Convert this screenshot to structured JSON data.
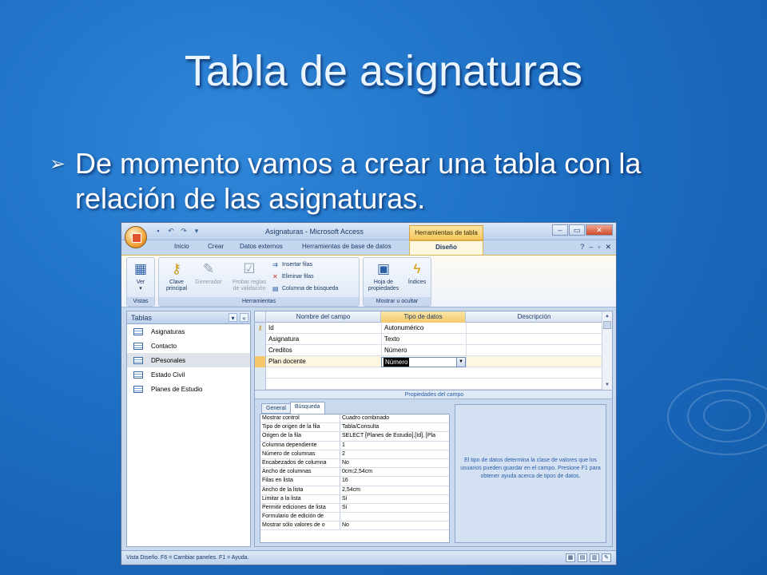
{
  "slide": {
    "title": "Tabla de asignaturas",
    "bullet_text": "De momento vamos a crear una tabla con la relación de las asignaturas."
  },
  "window": {
    "title": "Asignaturas - Microsoft Access",
    "context_tab": "Herramientas de tabla"
  },
  "ribbon_tabs": [
    "Inicio",
    "Crear",
    "Datos externos",
    "Herramientas de base de datos",
    "Diseño"
  ],
  "ribbon": {
    "vistas": {
      "label": "Vistas",
      "ver": "Ver"
    },
    "herramientas": {
      "label": "Herramientas",
      "clave_line1": "Clave",
      "clave_line2": "principal",
      "generador": "Generador",
      "probar_line1": "Probar reglas",
      "probar_line2": "de validación",
      "insertar": "Insertar filas",
      "eliminar": "Eliminar filas",
      "columna": "Columna de búsqueda"
    },
    "mostrar": {
      "label": "Mostrar u ocultar",
      "hoja_line1": "Hoja de",
      "hoja_line2": "propiedades",
      "indices": "Índices"
    }
  },
  "nav": {
    "header": "Tablas",
    "items": [
      "Asignaturas",
      "Contacto",
      "DPesonales",
      "Estado Civil",
      "Planes de Estudio"
    ],
    "selected_index": 2
  },
  "design_grid": {
    "headers": [
      "Nombre del campo",
      "Tipo de datos",
      "Descripción"
    ],
    "rows": [
      {
        "name": "Id",
        "type": "Autonumérico"
      },
      {
        "name": "Asignatura",
        "type": "Texto"
      },
      {
        "name": "Creditos",
        "type": "Número"
      },
      {
        "name": "Plan docente",
        "type": "Número"
      }
    ]
  },
  "properties": {
    "title": "Propiedades del campo",
    "tabs": [
      "General",
      "Búsqueda"
    ],
    "active_tab": "Búsqueda",
    "rows": [
      {
        "name": "Mostrar control",
        "value": "Cuadro combinado"
      },
      {
        "name": "Tipo de origen de la fila",
        "value": "Tabla/Consulta"
      },
      {
        "name": "Origen de la fila",
        "value": "SELECT [Planes de Estudio].[Id], [Pla"
      },
      {
        "name": "Columna dependiente",
        "value": "1"
      },
      {
        "name": "Número de columnas",
        "value": "2"
      },
      {
        "name": "Encabezados de columna",
        "value": "No"
      },
      {
        "name": "Ancho de columnas",
        "value": "0cm;2,54cm"
      },
      {
        "name": "Filas en lista",
        "value": "16"
      },
      {
        "name": "Ancho de la lista",
        "value": "2,54cm"
      },
      {
        "name": "Limitar a la lista",
        "value": "Sí"
      },
      {
        "name": "Permitir ediciones de lista",
        "value": "Sí"
      },
      {
        "name": "Formulario de edición de",
        "value": ""
      },
      {
        "name": "Mostrar sólo valores de o",
        "value": "No"
      }
    ],
    "help": "El tipo de datos determina la clase de valores que los usuarios pueden guardar en el campo. Presione F1 para obtener ayuda acerca de tipos de datos."
  },
  "statusbar": "Vista Diseño. F6 = Cambiar paneles. F1 = Ayuda.",
  "colors": {
    "accent": "#f5c65a",
    "slide_bg": "#1d6fc4"
  }
}
